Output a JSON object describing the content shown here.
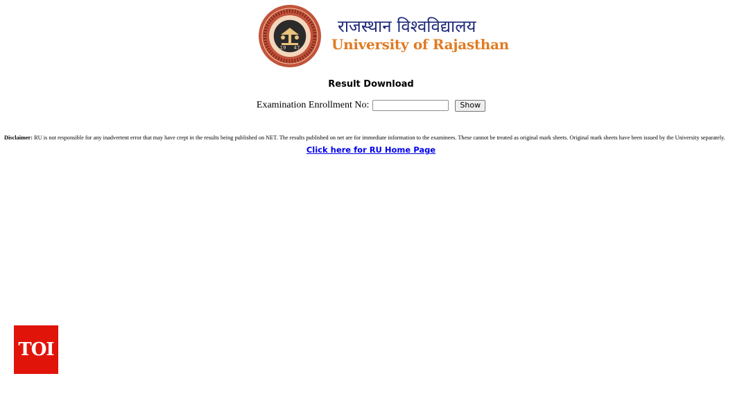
{
  "header": {
    "university_hindi": "राजस्थान विश्वविद्यालय",
    "university_english": "University of Rajasthan",
    "seal_numbers": [
      "19",
      "47"
    ]
  },
  "main": {
    "title": "Result Download",
    "enrollment_label": "Examination Enrollment No:",
    "enrollment_value": "",
    "show_button": "Show"
  },
  "disclaimer": {
    "label": "Disclaimer:",
    "text": " RU is not responsible for any inadvertent error that may have crept in the results being published on NET. The results published on net are for immediate information to the examinees. These cannot be treated as original mark sheets. Original mark sheets have been issued by the University separately."
  },
  "home_link": "Click here for RU Home Page",
  "watermark": "TOI",
  "colors": {
    "hindi_title": "#1f2a7a",
    "english_title": "#e07b22",
    "seal": "#b8432f",
    "link": "#0000ee",
    "watermark_bg": "#e1140a"
  }
}
